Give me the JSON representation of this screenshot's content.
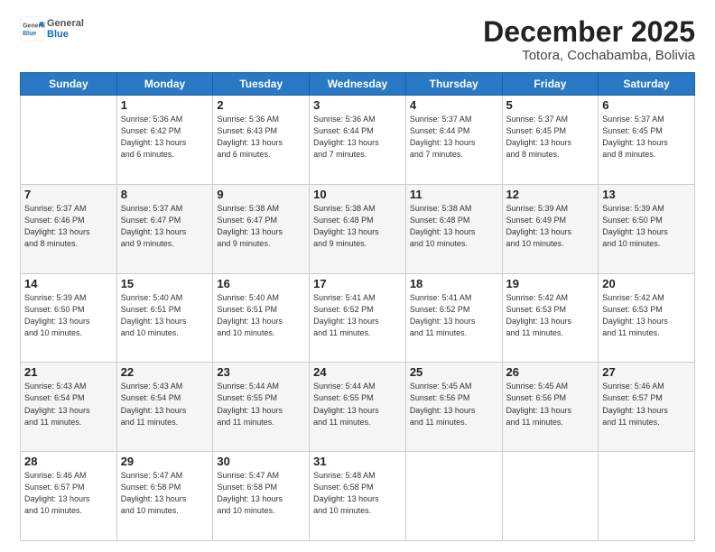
{
  "header": {
    "logo_general": "General",
    "logo_blue": "Blue",
    "title": "December 2025",
    "subtitle": "Totora, Cochabamba, Bolivia"
  },
  "weekdays": [
    "Sunday",
    "Monday",
    "Tuesday",
    "Wednesday",
    "Thursday",
    "Friday",
    "Saturday"
  ],
  "weeks": [
    [
      {
        "day": "",
        "info": ""
      },
      {
        "day": "1",
        "info": "Sunrise: 5:36 AM\nSunset: 6:42 PM\nDaylight: 13 hours\nand 6 minutes."
      },
      {
        "day": "2",
        "info": "Sunrise: 5:36 AM\nSunset: 6:43 PM\nDaylight: 13 hours\nand 6 minutes."
      },
      {
        "day": "3",
        "info": "Sunrise: 5:36 AM\nSunset: 6:44 PM\nDaylight: 13 hours\nand 7 minutes."
      },
      {
        "day": "4",
        "info": "Sunrise: 5:37 AM\nSunset: 6:44 PM\nDaylight: 13 hours\nand 7 minutes."
      },
      {
        "day": "5",
        "info": "Sunrise: 5:37 AM\nSunset: 6:45 PM\nDaylight: 13 hours\nand 8 minutes."
      },
      {
        "day": "6",
        "info": "Sunrise: 5:37 AM\nSunset: 6:45 PM\nDaylight: 13 hours\nand 8 minutes."
      }
    ],
    [
      {
        "day": "7",
        "info": "Sunrise: 5:37 AM\nSunset: 6:46 PM\nDaylight: 13 hours\nand 8 minutes."
      },
      {
        "day": "8",
        "info": "Sunrise: 5:37 AM\nSunset: 6:47 PM\nDaylight: 13 hours\nand 9 minutes."
      },
      {
        "day": "9",
        "info": "Sunrise: 5:38 AM\nSunset: 6:47 PM\nDaylight: 13 hours\nand 9 minutes."
      },
      {
        "day": "10",
        "info": "Sunrise: 5:38 AM\nSunset: 6:48 PM\nDaylight: 13 hours\nand 9 minutes."
      },
      {
        "day": "11",
        "info": "Sunrise: 5:38 AM\nSunset: 6:48 PM\nDaylight: 13 hours\nand 10 minutes."
      },
      {
        "day": "12",
        "info": "Sunrise: 5:39 AM\nSunset: 6:49 PM\nDaylight: 13 hours\nand 10 minutes."
      },
      {
        "day": "13",
        "info": "Sunrise: 5:39 AM\nSunset: 6:50 PM\nDaylight: 13 hours\nand 10 minutes."
      }
    ],
    [
      {
        "day": "14",
        "info": "Sunrise: 5:39 AM\nSunset: 6:50 PM\nDaylight: 13 hours\nand 10 minutes."
      },
      {
        "day": "15",
        "info": "Sunrise: 5:40 AM\nSunset: 6:51 PM\nDaylight: 13 hours\nand 10 minutes."
      },
      {
        "day": "16",
        "info": "Sunrise: 5:40 AM\nSunset: 6:51 PM\nDaylight: 13 hours\nand 10 minutes."
      },
      {
        "day": "17",
        "info": "Sunrise: 5:41 AM\nSunset: 6:52 PM\nDaylight: 13 hours\nand 11 minutes."
      },
      {
        "day": "18",
        "info": "Sunrise: 5:41 AM\nSunset: 6:52 PM\nDaylight: 13 hours\nand 11 minutes."
      },
      {
        "day": "19",
        "info": "Sunrise: 5:42 AM\nSunset: 6:53 PM\nDaylight: 13 hours\nand 11 minutes."
      },
      {
        "day": "20",
        "info": "Sunrise: 5:42 AM\nSunset: 6:53 PM\nDaylight: 13 hours\nand 11 minutes."
      }
    ],
    [
      {
        "day": "21",
        "info": "Sunrise: 5:43 AM\nSunset: 6:54 PM\nDaylight: 13 hours\nand 11 minutes."
      },
      {
        "day": "22",
        "info": "Sunrise: 5:43 AM\nSunset: 6:54 PM\nDaylight: 13 hours\nand 11 minutes."
      },
      {
        "day": "23",
        "info": "Sunrise: 5:44 AM\nSunset: 6:55 PM\nDaylight: 13 hours\nand 11 minutes."
      },
      {
        "day": "24",
        "info": "Sunrise: 5:44 AM\nSunset: 6:55 PM\nDaylight: 13 hours\nand 11 minutes."
      },
      {
        "day": "25",
        "info": "Sunrise: 5:45 AM\nSunset: 6:56 PM\nDaylight: 13 hours\nand 11 minutes."
      },
      {
        "day": "26",
        "info": "Sunrise: 5:45 AM\nSunset: 6:56 PM\nDaylight: 13 hours\nand 11 minutes."
      },
      {
        "day": "27",
        "info": "Sunrise: 5:46 AM\nSunset: 6:57 PM\nDaylight: 13 hours\nand 11 minutes."
      }
    ],
    [
      {
        "day": "28",
        "info": "Sunrise: 5:46 AM\nSunset: 6:57 PM\nDaylight: 13 hours\nand 10 minutes."
      },
      {
        "day": "29",
        "info": "Sunrise: 5:47 AM\nSunset: 6:58 PM\nDaylight: 13 hours\nand 10 minutes."
      },
      {
        "day": "30",
        "info": "Sunrise: 5:47 AM\nSunset: 6:58 PM\nDaylight: 13 hours\nand 10 minutes."
      },
      {
        "day": "31",
        "info": "Sunrise: 5:48 AM\nSunset: 6:58 PM\nDaylight: 13 hours\nand 10 minutes."
      },
      {
        "day": "",
        "info": ""
      },
      {
        "day": "",
        "info": ""
      },
      {
        "day": "",
        "info": ""
      }
    ]
  ]
}
